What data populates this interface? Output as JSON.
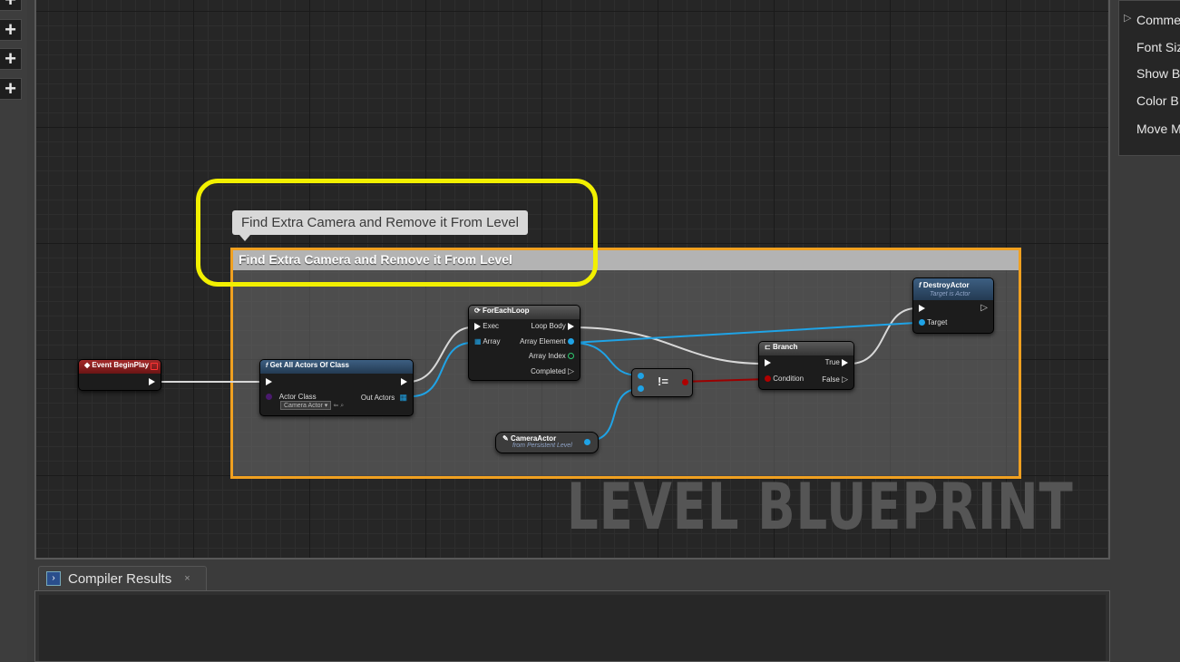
{
  "left_toolbar": {
    "buttons": [
      "+",
      "+",
      "+",
      "+"
    ]
  },
  "graph": {
    "watermark": "LEVEL BLUEPRINT",
    "comment_bubble": "Find Extra Camera and Remove it From Level",
    "comment_header": "Find Extra Camera and Remove it From Level",
    "nodes": {
      "event_begin_play": {
        "title": "Event BeginPlay"
      },
      "get_all_actors": {
        "title": "Get All Actors Of Class",
        "actor_class_label": "Actor Class",
        "actor_class_value": "Camera Actor",
        "out_actors_label": "Out Actors"
      },
      "for_each_loop": {
        "title": "ForEachLoop",
        "exec": "Exec",
        "loop_body": "Loop Body",
        "array": "Array",
        "array_element": "Array Element",
        "array_index": "Array Index",
        "completed": "Completed"
      },
      "not_equal": {
        "symbol": "!="
      },
      "branch": {
        "title": "Branch",
        "true": "True",
        "condition": "Condition",
        "false": "False"
      },
      "destroy_actor": {
        "title": "DestroyActor",
        "subtitle": "Target is Actor",
        "target": "Target"
      },
      "camera_actor": {
        "title": "CameraActor",
        "subtitle": "from Persistent Level"
      }
    }
  },
  "bottom_panel": {
    "tab_label": "Compiler Results",
    "tab_close": "×"
  },
  "details_panel": {
    "expand_arrow": "▷",
    "items": [
      "Comme",
      "Font Siz",
      "Show B",
      "Color B",
      "Move M"
    ]
  },
  "colors": {
    "comment_border": "#f0a020",
    "highlight_ring": "#f2f000",
    "event_header": "#8a1f1f",
    "function_header": "#2f4a66",
    "exec_wire": "#d8d8d8",
    "object_wire": "#1fa3e6",
    "bool_wire": "#9b0000"
  }
}
